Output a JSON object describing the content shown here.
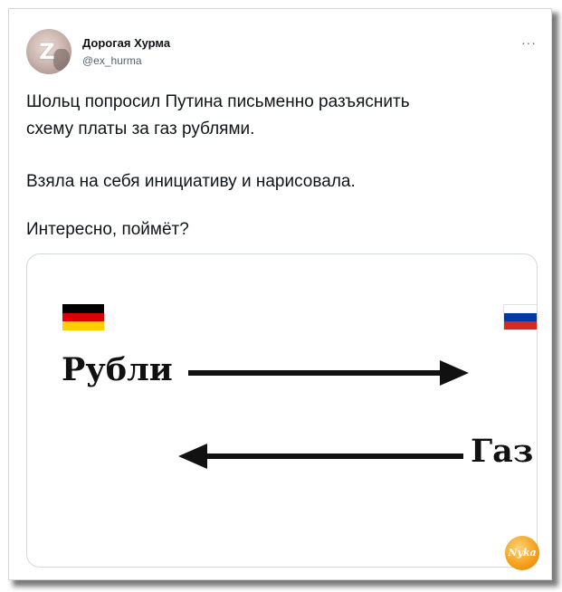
{
  "author": {
    "display_name": "Дорогая Хурма",
    "handle": "@ex_hurma",
    "avatar_icon": "avatar-z-logo"
  },
  "more_label": "···",
  "tweet": {
    "lines": [
      "Шольц попросил Путина письменно разъяснить",
      "схему платы за газ рублями.",
      "Взяла на себя инициативу и нарисовала.",
      "Интересно, поймёт?"
    ]
  },
  "media": {
    "flag_left": "germany-flag-icon",
    "flag_right": "russia-flag-icon",
    "word_top": "Рубли",
    "word_bottom": "Газ",
    "arrow_top_direction": "right",
    "arrow_bottom_direction": "left"
  },
  "colors": {
    "de_black": "#000000",
    "de_red": "#dd0000",
    "de_gold": "#ffce00",
    "ru_white": "#ffffff",
    "ru_blue": "#0039a6",
    "ru_red": "#d52b1e"
  },
  "watermark": "Nyka"
}
